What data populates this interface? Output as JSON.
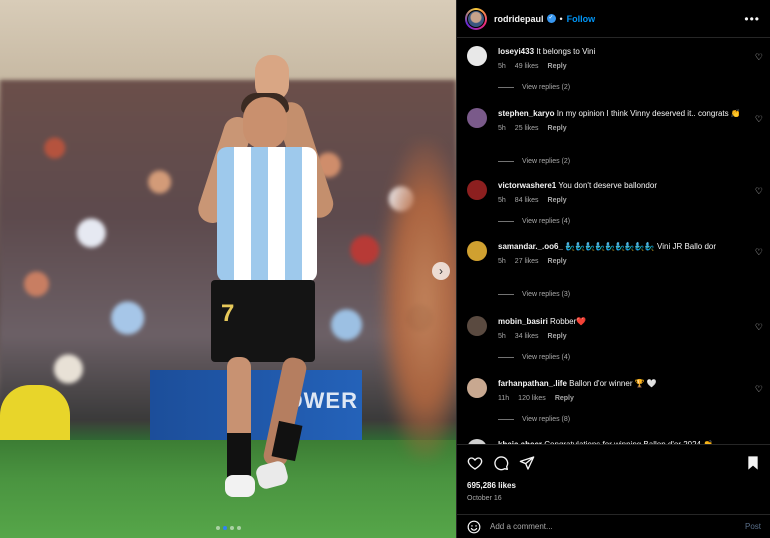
{
  "photo": {
    "adboard_text": "OWER",
    "shorts_number": "7",
    "carousel_dots": 4,
    "active_dot": 1
  },
  "header": {
    "username": "rodridepaul",
    "separator": "•",
    "follow_label": "Follow",
    "more_label": "•••"
  },
  "comments": [
    {
      "user": "loseyi433",
      "text": "It belongs to Vini",
      "time": "5h",
      "likes": "49 likes",
      "reply": "Reply",
      "view_replies": "View replies (2)",
      "avatar_color": "#e8e8e8"
    },
    {
      "user": "stephen_karyo",
      "text": "In my opinion I think Vinny deserved it.. congrats 👏",
      "time": "5h",
      "likes": "25 likes",
      "reply": "Reply",
      "view_replies": "View replies (2)",
      "avatar_color": "#7a5a8a"
    },
    {
      "user": "victorwashere1",
      "text": "You don't deserve ballondor",
      "time": "5h",
      "likes": "84 likes",
      "reply": "Reply",
      "view_replies": "View replies (4)",
      "avatar_color": "#8c1f1f"
    },
    {
      "user": "samandar._.oo6_",
      "text": "🧞‍♂️🧞‍♂️🧞‍♂️🧞‍♂️🧞‍♂️🧞‍♂️🧞‍♂️🧞‍♂️🧞‍♂️ Vini JR Ballo dor",
      "time": "5h",
      "likes": "27 likes",
      "reply": "Reply",
      "view_replies": "View replies (3)",
      "avatar_color": "#d0a030"
    },
    {
      "user": "mobin_basiri",
      "text": "Robber❤️",
      "time": "5h",
      "likes": "34 likes",
      "reply": "Reply",
      "view_replies": "View replies (4)",
      "avatar_color": "#5a4a40"
    },
    {
      "user": "farhanpathan_.life",
      "text": "Ballon d'or winner 🏆 🤍",
      "time": "11h",
      "likes": "120 likes",
      "reply": "Reply",
      "view_replies": "View replies (8)",
      "avatar_color": "#c8a890"
    },
    {
      "user": "khaja.aheer",
      "text": "Congratulations for winning Ballon d'or 2024 👏",
      "time": "",
      "likes": "",
      "reply": "",
      "view_replies": "",
      "avatar_color": "#d0d0d0"
    }
  ],
  "actions": {
    "likes": "695,286 likes",
    "date": "October 16",
    "icons": [
      "heart-icon",
      "comment-icon",
      "share-icon",
      "bookmark-icon"
    ]
  },
  "add_comment": {
    "placeholder": "Add a comment...",
    "post_label": "Post"
  },
  "colors": {
    "accent": "#0095f6",
    "background": "#000000",
    "verified": "#3897f0"
  }
}
